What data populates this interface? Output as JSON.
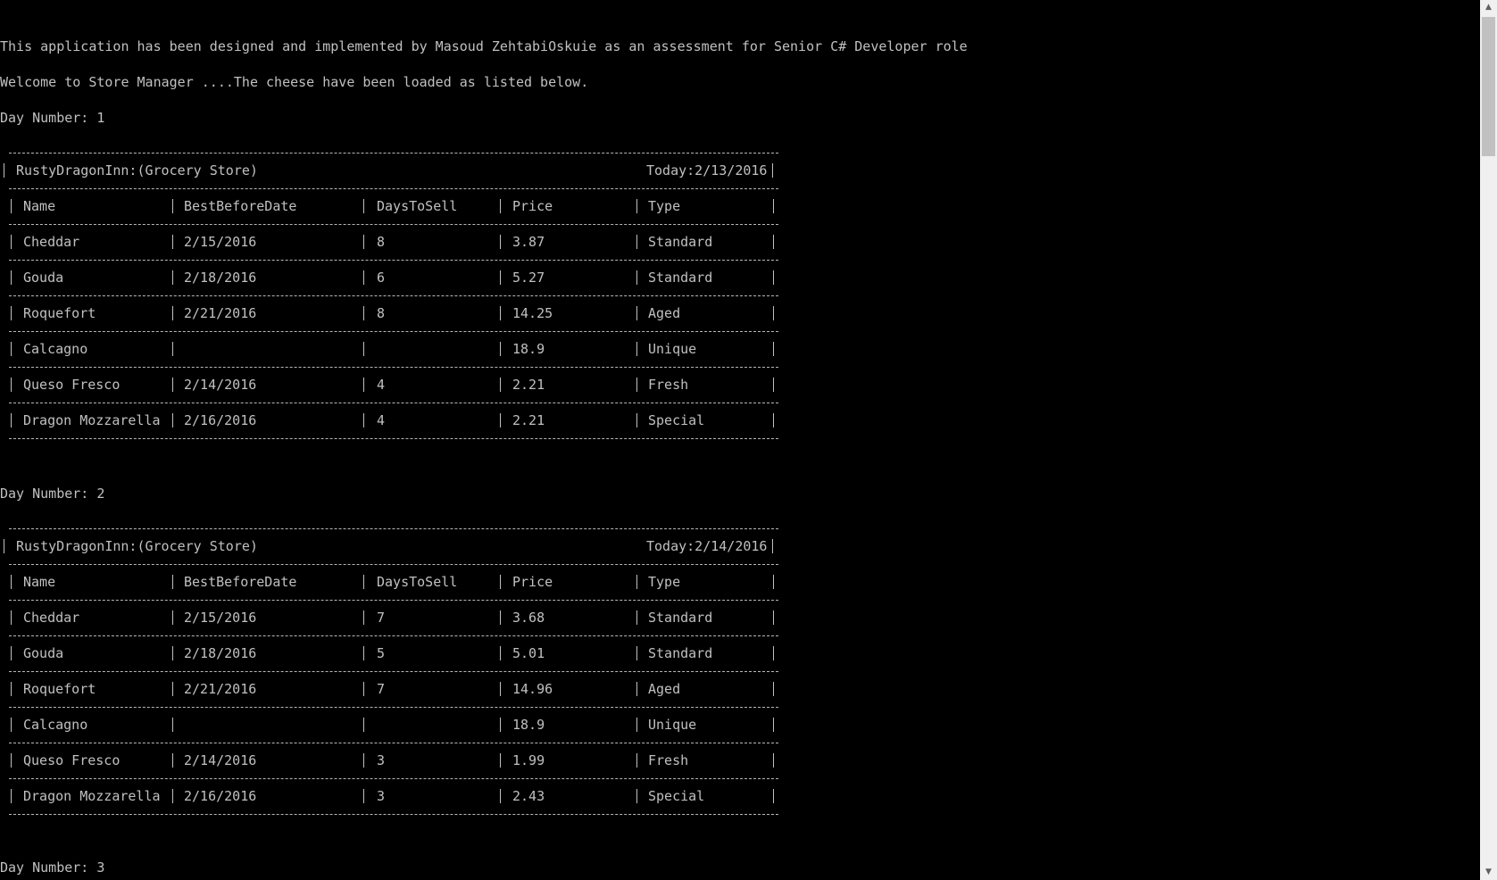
{
  "console": {
    "intro": "This application has been designed and implemented by Masoud ZehtabiOskuie as an assessment for Senior C# Developer role",
    "welcome": "Welcome to Store Manager ....The cheese have been loaded as listed below.",
    "store_name": "RustyDragonInn:(Grocery Store)",
    "columns": [
      "Name",
      "BestBeforeDate",
      "DaysToSell",
      "Price",
      "Type"
    ],
    "days": [
      {
        "label": "Day Number: 1",
        "today": "Today:2/13/2016",
        "rows": [
          [
            "Cheddar",
            "2/15/2016",
            "8",
            "3.87",
            "Standard"
          ],
          [
            "Gouda",
            "2/18/2016",
            "6",
            "5.27",
            "Standard"
          ],
          [
            "Roquefort",
            "2/21/2016",
            "8",
            "14.25",
            "Aged"
          ],
          [
            "Calcagno",
            "",
            "",
            "18.9",
            "Unique"
          ],
          [
            "Queso Fresco",
            "2/14/2016",
            "4",
            "2.21",
            "Fresh"
          ],
          [
            "Dragon Mozzarella",
            "2/16/2016",
            "4",
            "2.21",
            "Special"
          ]
        ]
      },
      {
        "label": "Day Number: 2",
        "today": "Today:2/14/2016",
        "rows": [
          [
            "Cheddar",
            "2/15/2016",
            "7",
            "3.68",
            "Standard"
          ],
          [
            "Gouda",
            "2/18/2016",
            "5",
            "5.01",
            "Standard"
          ],
          [
            "Roquefort",
            "2/21/2016",
            "7",
            "14.96",
            "Aged"
          ],
          [
            "Calcagno",
            "",
            "",
            "18.9",
            "Unique"
          ],
          [
            "Queso Fresco",
            "2/14/2016",
            "3",
            "1.99",
            "Fresh"
          ],
          [
            "Dragon Mozzarella",
            "2/16/2016",
            "3",
            "2.43",
            "Special"
          ]
        ]
      },
      {
        "label": "Day Number: 3"
      }
    ]
  },
  "scrollbar": {
    "up_icon": "triangle-up-icon",
    "down_icon": "triangle-down-icon"
  }
}
